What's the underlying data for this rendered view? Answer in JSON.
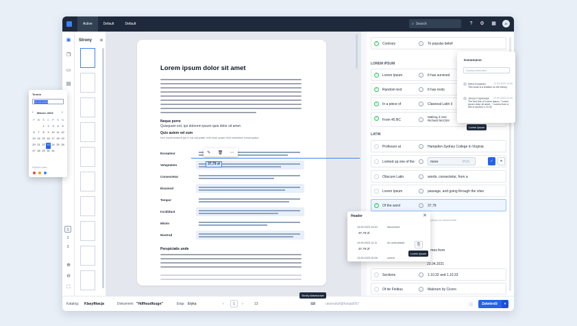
{
  "topbar": {
    "tabs": [
      "Active",
      "Default",
      "Default"
    ],
    "search_placeholder": "Search",
    "avatar": "JK"
  },
  "pages_panel": {
    "title": "Strony",
    "pager": [
      "1",
      "2",
      "3"
    ]
  },
  "document": {
    "title": "Lorem ipsum dolor sit amet",
    "section1_heading": "Neque porro",
    "section1_text": "Quisquam est, qui dolorem ipsum quia dolor sit amet.",
    "section2_heading": "Quis autem vel eum",
    "section2_text": "Iure reprehenderit qui in ea voluptate velit esse quam nihil molestiae consequatur",
    "highlight_value": "37,79 zł",
    "table_keys": [
      "Excepteur",
      "Voluptatem",
      "Consectetur",
      "Eiusmod",
      "Tempor",
      "Incididunt",
      "Minim",
      "Nostrud"
    ],
    "section3_heading": "Perspiciatis unde"
  },
  "calendar": {
    "title": "Termin",
    "input_value": "13.03.2023",
    "month": "Marzec 2023",
    "weekdays": [
      "P",
      "W",
      "Ś",
      "C",
      "P",
      "S",
      "N"
    ],
    "days": [
      "",
      "",
      "1",
      "2",
      "3",
      "4",
      "5",
      "6",
      "7",
      "8",
      "9",
      "10",
      "11",
      "12",
      "13",
      "14",
      "15",
      "16",
      "17",
      "18",
      "19",
      "20",
      "21",
      "22",
      "23",
      "24",
      "25",
      "26",
      "27",
      "28",
      "29",
      "30",
      "31",
      "",
      ""
    ],
    "selected_day": "23",
    "colors_label": "Wybierz kolor",
    "colors": [
      "#ef4444",
      "#f59e0b",
      "#3b82f6"
    ]
  },
  "right_panel": {
    "rows_top": [
      {
        "label": "Contrary",
        "value": "To popular belief",
        "checked": true
      }
    ],
    "section_lorem": "LOREM IPSUM",
    "rows_lorem": [
      {
        "label": "Lorem Ipsum",
        "value": "It has survived",
        "checked": true
      },
      {
        "label": "Random text",
        "value": "It has roots",
        "checked": true
      },
      {
        "label": "In a piece of",
        "value": "Classical Latin li",
        "checked": true
      },
      {
        "label": "From 45 BC",
        "value": "Making it over\nRichard McClint",
        "checked": true
      }
    ],
    "section_latin": "LATIN",
    "rows_latin": [
      {
        "label": "Professor at",
        "value": "Hampden-Sydney College in Virginia"
      },
      {
        "label": "Looked up one of the",
        "value": "more",
        "unit": "PLN"
      },
      {
        "label": "Obscure Latin",
        "value": "words, consectetur, from a"
      },
      {
        "label": "Lorem Ipsum",
        "value": "passage, and going through the cites"
      },
      {
        "label": "Of the word",
        "value": "37,79"
      },
      {
        "label": "",
        "value": "ąz parwy za dokumentie"
      },
      {
        "label": "",
        "value": "comes from"
      },
      {
        "label": "",
        "value": "23.04.2021"
      },
      {
        "label": "Sections",
        "value": "1.10.32 and 1.10.33"
      },
      {
        "label": "Of de Finibus",
        "value": "Malorum by Cicero"
      }
    ]
  },
  "comments": {
    "title": "Komentarze",
    "placeholder": "Dodaj komentarz",
    "items": [
      {
        "author": "Adina Kowalska",
        "date": "12.09.2023 12:00",
        "text": "This book is a treatise on the theory"
      },
      {
        "author": "Janusz Frąckowiak",
        "date": "12.09.2023 12:00",
        "text": "The first line of Lorem Ipsum, \"Lorem ipsum dolor sit amet..\", comes from a line in section 1.10.32"
      }
    ],
    "tooltip": "Lorem Ipsum"
  },
  "header_popup": {
    "title": "Header",
    "entries": [
      {
        "date": "13.09.2023 13:00",
        "tag": "discovered",
        "value": "37,79 zł"
      },
      {
        "date": "13.09.2023 12:11",
        "tag": "ihc unducitdsbr",
        "value": "37,79 zł"
      },
      {
        "date": "13.09.2023 10:08",
        "tag": "source",
        "value": ""
      }
    ],
    "tooltip": "Lorem Ipsum"
  },
  "bottombar": {
    "catalog_label": "Katalog:",
    "catalog_value": "Klasyfikacja",
    "doc_label": "Dokument:",
    "doc_value": "\"Hdfhsudfuugn\"",
    "stage_label": "Etap:",
    "stage_value": "Etyka",
    "page_current": "1",
    "page_total": "13",
    "shortcuts_tooltip": "Skróty klawiszowe",
    "link_text": "ukamakaf@hsiajai057",
    "confirm": "Zatwierdź"
  }
}
